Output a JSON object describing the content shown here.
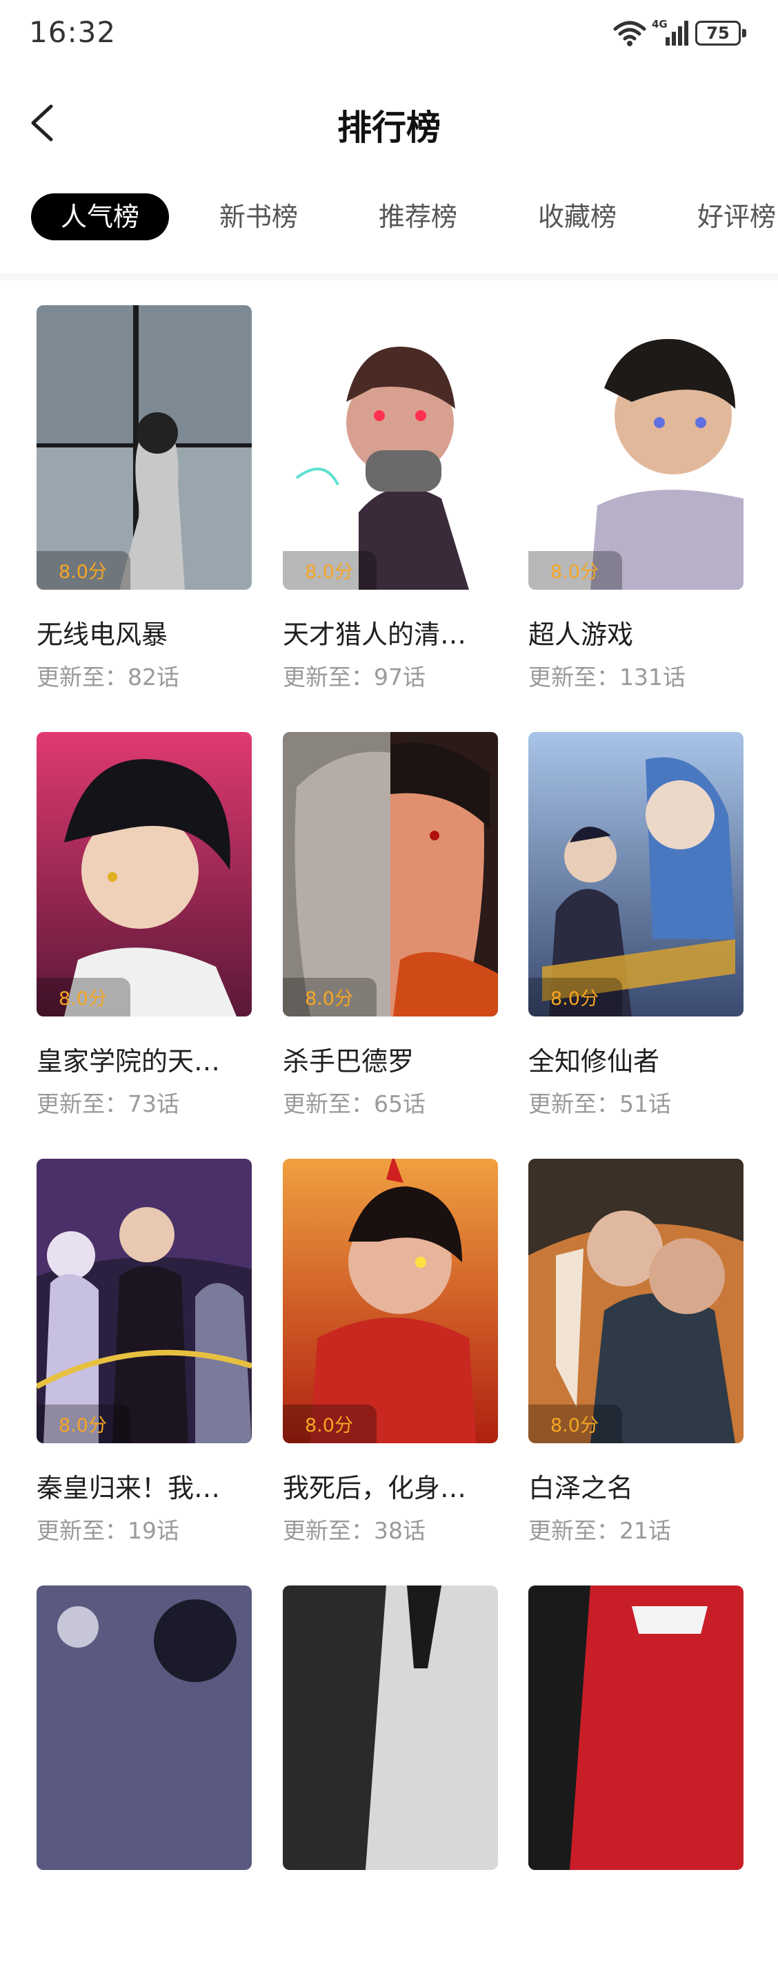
{
  "status": {
    "time": "16:32",
    "network": "4G",
    "battery": "75"
  },
  "header": {
    "title": "排行榜"
  },
  "tabs": [
    {
      "label": "人气榜",
      "active": true
    },
    {
      "label": "新书榜",
      "active": false
    },
    {
      "label": "推荐榜",
      "active": false
    },
    {
      "label": "收藏榜",
      "active": false
    },
    {
      "label": "好评榜",
      "active": false
    }
  ],
  "comics": [
    {
      "title": "无线电风暴",
      "score": "8.0分",
      "update": "更新至：82话",
      "cover_colors": [
        "#6f7c86",
        "#aeb9c1"
      ]
    },
    {
      "title": "天才猎人的清…",
      "score": "8.0分",
      "update": "更新至：97话",
      "cover_colors": [
        "#ffffff",
        "#8a2430"
      ]
    },
    {
      "title": "超人游戏",
      "score": "8.0分",
      "update": "更新至：131话",
      "cover_colors": [
        "#ffffff",
        "#3a2e2a"
      ]
    },
    {
      "title": "皇家学院的天…",
      "score": "8.0分",
      "update": "更新至：73话",
      "cover_colors": [
        "#d23a6e",
        "#2a1f2c"
      ]
    },
    {
      "title": "杀手巴德罗",
      "score": "8.0分",
      "update": "更新至：65话",
      "cover_colors": [
        "#8d8680",
        "#c4532a"
      ]
    },
    {
      "title": "全知修仙者",
      "score": "8.0分",
      "update": "更新至：51话",
      "cover_colors": [
        "#6d8ec4",
        "#2a3550"
      ]
    },
    {
      "title": "秦皇归来！我…",
      "score": "8.0分",
      "update": "更新至：19话",
      "cover_colors": [
        "#3a2a55",
        "#c9a23a"
      ]
    },
    {
      "title": "我死后，化身…",
      "score": "8.0分",
      "update": "更新至：38话",
      "cover_colors": [
        "#e0492a",
        "#7a1414"
      ]
    },
    {
      "title": "白泽之名",
      "score": "8.0分",
      "update": "更新至：21话",
      "cover_colors": [
        "#d07a3a",
        "#2a3440"
      ]
    },
    {
      "title": "",
      "score": "",
      "update": "",
      "cover_colors": [
        "#5a5a80",
        "#c6c6d8"
      ]
    },
    {
      "title": "",
      "score": "",
      "update": "",
      "cover_colors": [
        "#2a2a2a",
        "#d8d8d8"
      ]
    },
    {
      "title": "",
      "score": "",
      "update": "",
      "cover_colors": [
        "#c81e28",
        "#1a1a1a"
      ]
    }
  ]
}
